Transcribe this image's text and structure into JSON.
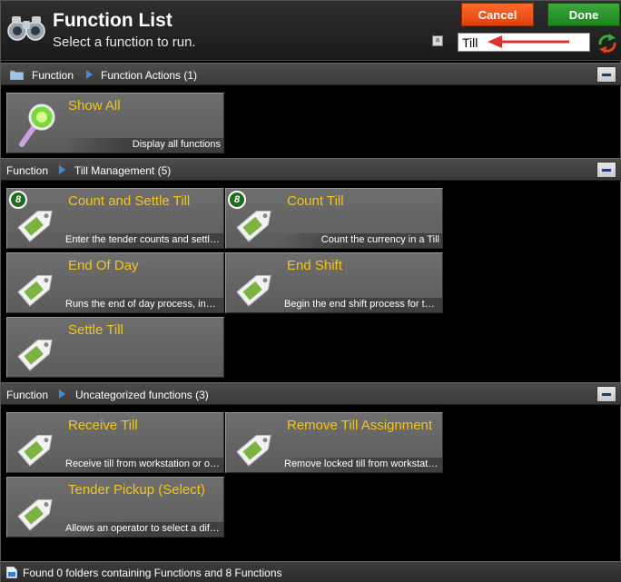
{
  "header": {
    "title": "Function List",
    "subtitle": "Select a function to run.",
    "cancel_label": "Cancel",
    "done_label": "Done",
    "search_value": "Till"
  },
  "sections": [
    {
      "crumb_root": "Function",
      "crumb_child": "Function Actions (1)",
      "tiles": [
        {
          "label": "Show All",
          "desc": "Display all functions"
        }
      ]
    },
    {
      "crumb_root": "Function",
      "crumb_child": "Till Management (5)",
      "tiles": [
        {
          "label": "Count and Settle Till",
          "desc": "Enter the tender counts and settle the till",
          "badge": "8"
        },
        {
          "label": "Count Till",
          "desc": "Count the currency in a Till",
          "badge": "8"
        },
        {
          "label": "End Of Day",
          "desc": "Runs the end of day process, including settlement"
        },
        {
          "label": "End Shift",
          "desc": "Begin the end shift process for the till"
        },
        {
          "label": "Settle Till",
          "desc": ""
        }
      ]
    },
    {
      "crumb_root": "Function",
      "crumb_child": "Uncategorized functions (3)",
      "tiles": [
        {
          "label": "Receive Till",
          "desc": "Receive till from workstation or operator"
        },
        {
          "label": "Remove Till Assignment",
          "desc": "Remove locked till from workstation"
        },
        {
          "label": "Tender Pickup (Select)",
          "desc": "Allows an operator to select a different tender"
        }
      ]
    }
  ],
  "status": {
    "text": "Found 0 folders containing Functions and 8 Functions"
  },
  "colors": {
    "tile_label": "#f5c518",
    "cancel": "#ff5a1e",
    "done": "#2a9a2a",
    "badge": "#1f6e1f",
    "annotation_arrow": "#e03030"
  }
}
